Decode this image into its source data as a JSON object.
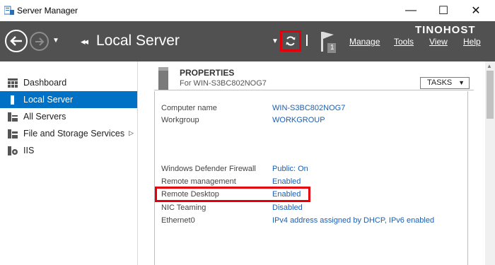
{
  "window": {
    "title": "Server Manager",
    "minimize": "—",
    "maximize": "☐",
    "close": "✕"
  },
  "header": {
    "breadcrumb_arrows": "◂◂",
    "page_title": "Local Server",
    "menu": {
      "manage": "Manage",
      "tools": "Tools",
      "view": "View",
      "help": "Help"
    },
    "brand": "TINOHOST",
    "notification_count": "1"
  },
  "sidebar": {
    "items": [
      {
        "label": "Dashboard",
        "icon": "dashboard-icon"
      },
      {
        "label": "Local Server",
        "icon": "local-server-icon",
        "selected": true
      },
      {
        "label": "All Servers",
        "icon": "all-servers-icon"
      },
      {
        "label": "File and Storage Services",
        "icon": "storage-icon"
      },
      {
        "label": "IIS",
        "icon": "iis-icon"
      }
    ]
  },
  "properties": {
    "title": "PROPERTIES",
    "subtitle": "For WIN-S3BC802NOG7",
    "tasks_label": "TASKS",
    "rows": [
      {
        "label": "Computer name",
        "value": "WIN-S3BC802NOG7"
      },
      {
        "label": "Workgroup",
        "value": "WORKGROUP"
      },
      {
        "label": "Windows Defender Firewall",
        "value": "Public: On"
      },
      {
        "label": "Remote management",
        "value": "Enabled"
      },
      {
        "label": "Remote Desktop",
        "value": "Enabled"
      },
      {
        "label": "NIC Teaming",
        "value": "Disabled"
      },
      {
        "label": "Ethernet0",
        "value": "IPv4 address assigned by DHCP, IPv6 enabled"
      }
    ]
  },
  "colors": {
    "header_bg": "#515151",
    "selection": "#0071c5",
    "link": "#1a5fb4",
    "highlight": "#e3000b"
  }
}
